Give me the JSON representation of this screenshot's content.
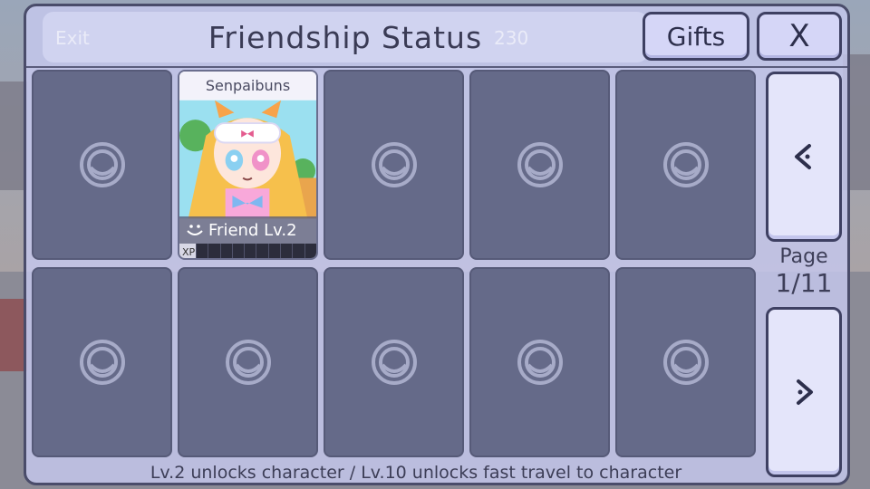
{
  "background_hud": {
    "exit_label": "Exit",
    "gems_count": "230"
  },
  "modal": {
    "title": "Friendship Status",
    "gifts_label": "Gifts",
    "close_label": "X"
  },
  "characters": [
    {
      "name": "Senpaibuns",
      "unlocked": true,
      "status": "Friend Lv.2",
      "xp_label": "XP"
    }
  ],
  "empty_slot_icon": "empty-slot-icon",
  "pagination": {
    "label": "Page",
    "current": "1/11",
    "prev_icon": "chevron-left-icon",
    "next_icon": "chevron-right-icon"
  },
  "footer_text": "Lv.2 unlocks character / Lv.10 unlocks fast travel to character",
  "colors": {
    "modal_bg": "#c6c8ee",
    "card_empty": "#656a89",
    "border": "#3e4062",
    "text": "#3a3b55"
  }
}
